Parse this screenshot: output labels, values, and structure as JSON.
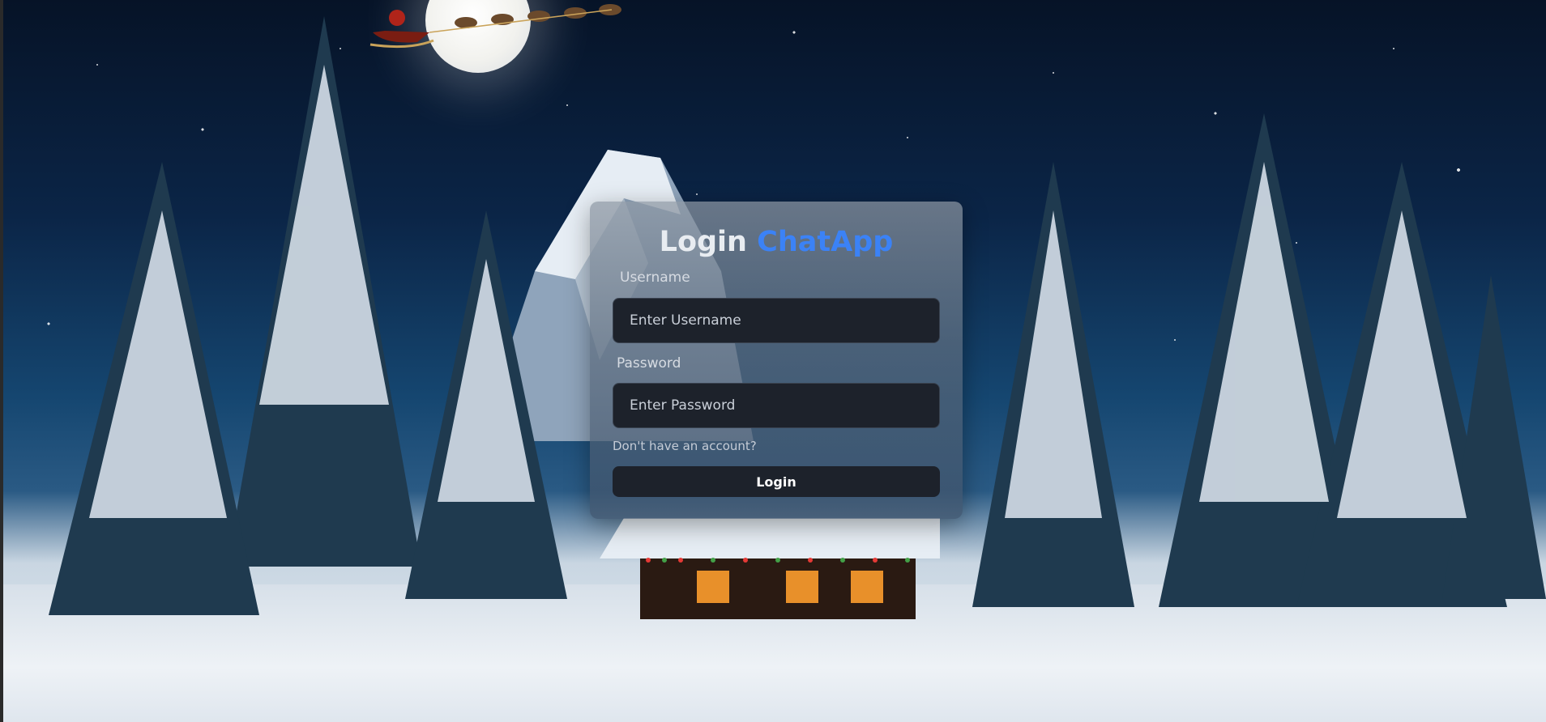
{
  "login": {
    "title_prefix": "Login",
    "title_brand": "ChatApp",
    "username_label": "Username",
    "username_placeholder": "Enter Username",
    "username_value": "",
    "password_label": "Password",
    "password_placeholder": "Enter Password",
    "password_value": "",
    "signup_link": "Don't have an account?",
    "submit_label": "Login"
  },
  "colors": {
    "brand": "#3b82f6",
    "input_bg": "#1d222b",
    "button_bg": "#1d222b"
  }
}
